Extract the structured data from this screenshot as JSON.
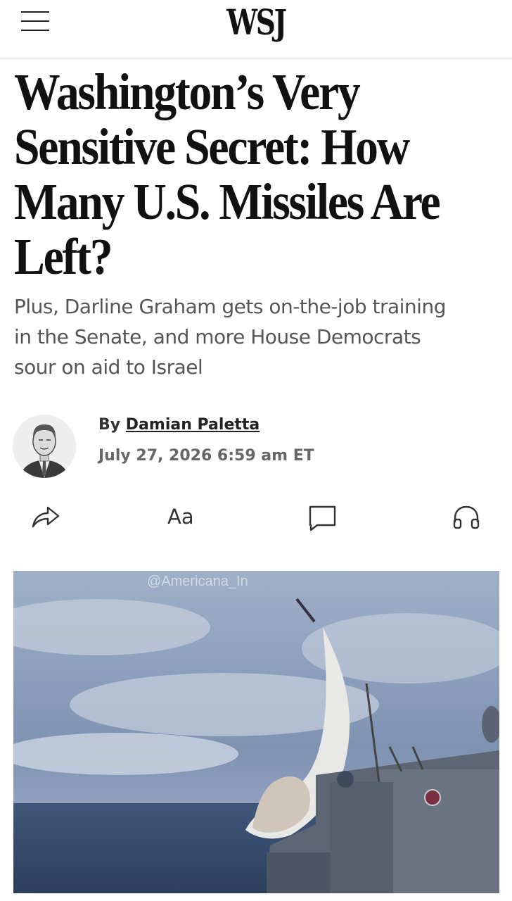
{
  "header": {
    "logo": "WSJ",
    "menu_icon": "hamburger-menu-icon"
  },
  "article": {
    "headline": [
      "Washington’s Very",
      "Sensitive Secret: How",
      "Many U.S. Missiles Are",
      "Left?"
    ],
    "subheadline": [
      "Plus, Darline Graham gets on-the-job training",
      "in the Senate, and more House Democrats",
      "sour on aid to Israel"
    ],
    "byline_prefix": "By",
    "author": "Damian Paletta",
    "date": "July 27, 2026 6:59 am ET"
  },
  "toolbar": {
    "share_icon": "share-icon",
    "text_size_label": "Aa",
    "comments_icon": "comment-icon",
    "listen_icon": "headphones-icon"
  },
  "image": {
    "watermark": "@Americana_In",
    "description_icon": "missile-launch-photo"
  },
  "colors": {
    "text": "#111111",
    "subhead": "#555555",
    "date": "#666666",
    "divider": "#d9d9d9"
  }
}
